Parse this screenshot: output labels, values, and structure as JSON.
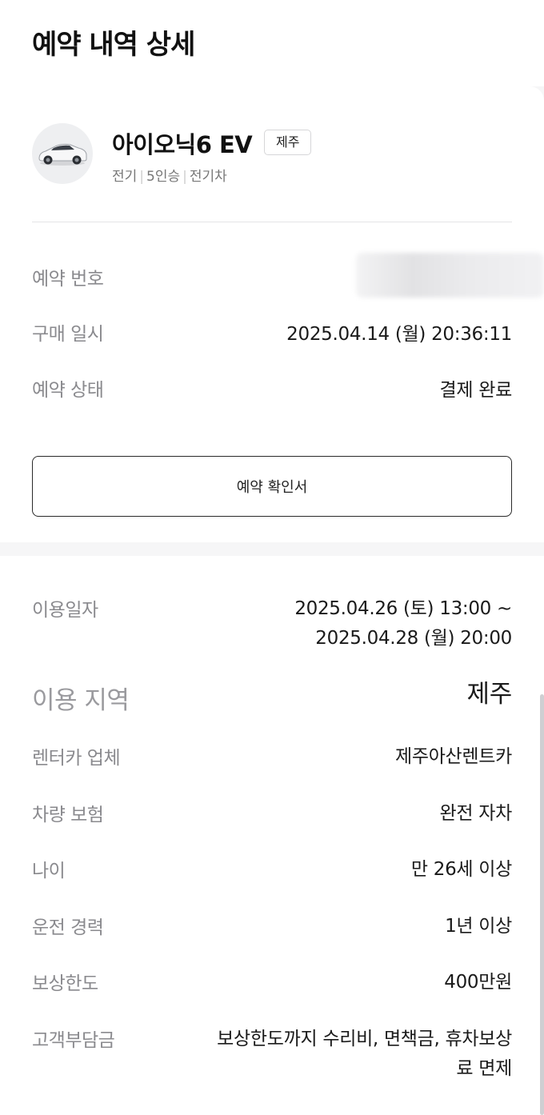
{
  "header": {
    "title": "예약 내역 상세"
  },
  "car": {
    "name": "아이오닉6 EV",
    "region_badge": "제주",
    "tags": [
      "전기",
      "5인승",
      "전기차"
    ],
    "image_icon": "car-photo"
  },
  "reservation": {
    "number_label": "예약 번호",
    "purchase_label": "구매 일시",
    "purchase_value": "2025.04.14 (월) 20:36:11",
    "status_label": "예약 상태",
    "status_value": "결제 완료",
    "confirm_button": "예약 확인서"
  },
  "usage": {
    "period_label": "이용일자",
    "period_line1": "2025.04.26 (토) 13:00 ~",
    "period_line2": "2025.04.28 (월) 20:00",
    "area_label": "이용 지역",
    "area_value": "제주",
    "company_label": "렌터카 업체",
    "company_value": "제주아산렌트카",
    "insurance_label": "차량 보험",
    "insurance_value": "완전 자차",
    "age_label": "나이",
    "age_value": "만 26세 이상",
    "experience_label": "운전 경력",
    "experience_value": "1년 이상",
    "coverage_label": "보상한도",
    "coverage_value": "400만원",
    "deductible_label": "고객부담금",
    "deductible_line1": "보상한도까지 수리비, 면책금, 휴차보상",
    "deductible_line2": "료 면제"
  }
}
